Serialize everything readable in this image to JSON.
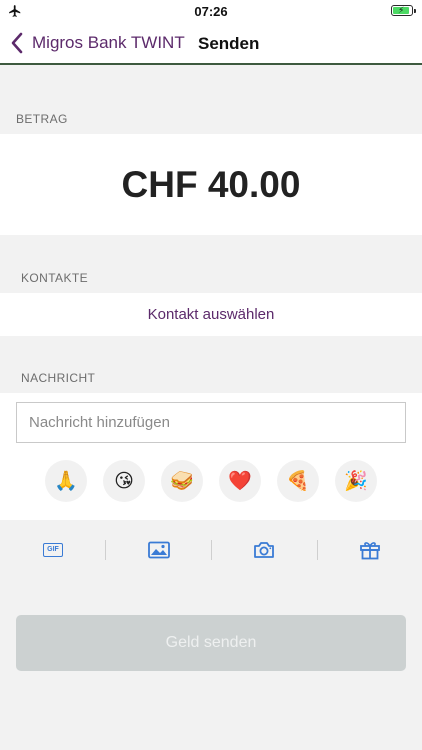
{
  "status_bar": {
    "time": "07:26"
  },
  "nav": {
    "back_label": "Migros Bank TWINT",
    "title": "Senden"
  },
  "amount": {
    "label": "BETRAG",
    "value": "CHF 40.00"
  },
  "contacts": {
    "label": "KONTAKTE",
    "select_link": "Kontakt auswählen"
  },
  "message": {
    "label": "NACHRICHT",
    "placeholder": "Nachricht hinzufügen",
    "value": "",
    "emojis": [
      "🙏",
      "😘",
      "🥪",
      "❤️",
      "🍕",
      "🎉"
    ]
  },
  "toolbar": {
    "gif_label": "GIF",
    "icons": [
      "gif-icon",
      "image-icon",
      "camera-icon",
      "gift-icon"
    ],
    "accent": "#3a7bd5"
  },
  "send_button": {
    "label": "Geld senden"
  },
  "colors": {
    "brand": "#5c2a6b",
    "divider": "#3d5a3f",
    "disabled": "#ccd1d1"
  }
}
